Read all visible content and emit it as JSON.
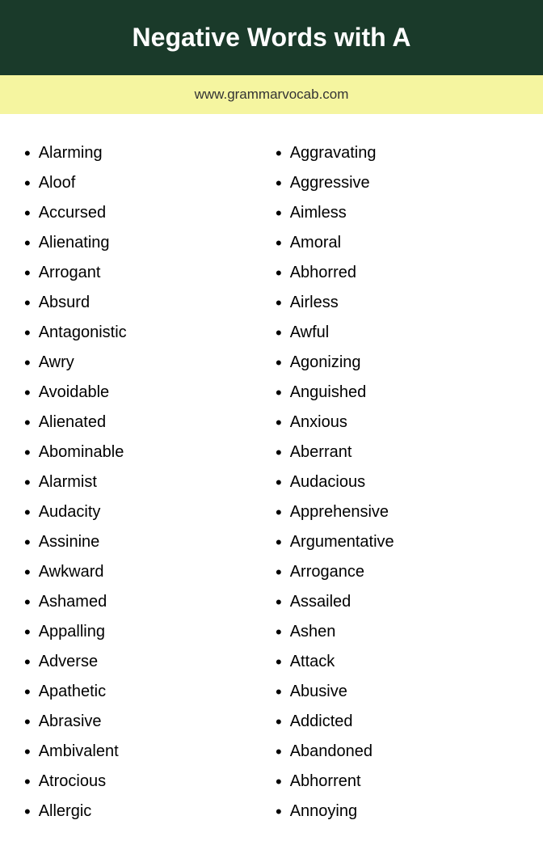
{
  "header": {
    "title": "Negative Words with A"
  },
  "banner": {
    "website": "www.grammarvocab.com"
  },
  "columns": {
    "left": [
      "Alarming",
      "Aloof",
      "Accursed",
      "Alienating",
      "Arrogant",
      "Absurd",
      "Antagonistic",
      "Awry",
      "Avoidable",
      "Alienated",
      "Abominable",
      "Alarmist",
      "Audacity",
      "Assinine",
      "Awkward",
      "Ashamed",
      "Appalling",
      "Adverse",
      "Apathetic",
      "Abrasive",
      "Ambivalent",
      "Atrocious",
      "Allergic"
    ],
    "right": [
      "Aggravating",
      "Aggressive",
      "Aimless",
      "Amoral",
      "Abhorred",
      "Airless",
      "Awful",
      "Agonizing",
      "Anguished",
      "Anxious",
      "Aberrant",
      "Audacious",
      "Apprehensive",
      "Argumentative",
      "Arrogance",
      "Assailed",
      "Ashen",
      "Attack",
      "Abusive",
      "Addicted",
      "Abandoned",
      "Abhorrent",
      "Annoying"
    ]
  }
}
